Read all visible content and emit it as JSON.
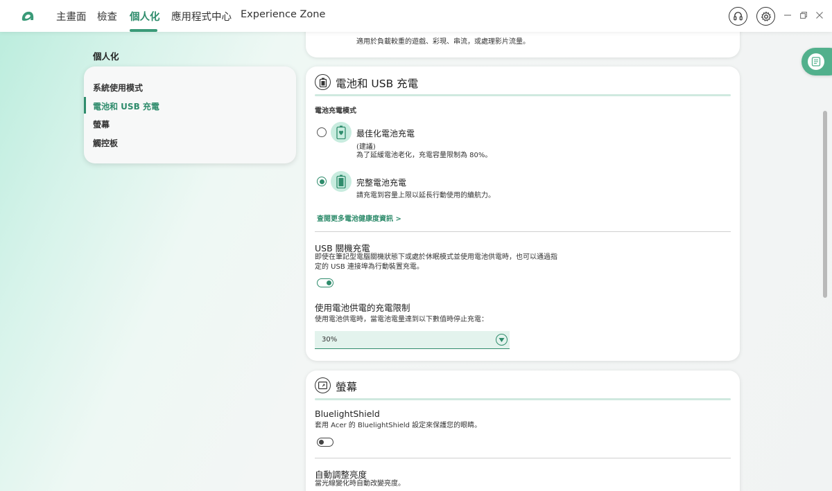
{
  "nav": {
    "tabs": [
      {
        "label": "主畫面"
      },
      {
        "label": "檢查"
      },
      {
        "label": "個人化"
      },
      {
        "label": "應用程式中心"
      },
      {
        "label": "Experience Zone"
      }
    ],
    "active_tab": "個人化"
  },
  "sidebar": {
    "section_title": "個人化",
    "items": [
      {
        "label": "系統使用模式"
      },
      {
        "label": "電池和 USB 充電"
      },
      {
        "label": "螢幕"
      },
      {
        "label": "觸控板"
      }
    ]
  },
  "top_card": {
    "description": "適用於負載較重的遊戲、彩現、串流，或處理影片流量。"
  },
  "battery_card": {
    "title": "電池和 USB 充電",
    "charge_mode_label": "電池充電模式",
    "options": [
      {
        "title": "最佳化電池充電",
        "note": "(建議)",
        "desc": "為了延緩電池老化，充電容量限制為 80%。",
        "selected": false
      },
      {
        "title": "完整電池充電",
        "desc": "請充電到容量上限以延長行動使用的續航力。",
        "selected": true
      }
    ],
    "health_link": "查閱更多電池健康度資訊 >",
    "usb_off_charge": {
      "title": "USB 關機充電",
      "desc_line1": "即使在筆記型電腦關機狀態下或處於休眠模式並使用電池供電時，也可以通過指",
      "desc_line2": "定的 USB 連接埠為行動裝置充電。",
      "enabled": true
    },
    "battery_limit": {
      "title": "使用電池供電的充電限制",
      "desc": "使用電池供電時，當電池電量達到以下數值時停止充電：",
      "selected_value": "30%"
    }
  },
  "screen_card": {
    "title": "螢幕",
    "bluelight": {
      "title": "BluelightShield",
      "desc": "套用 Acer 的 BluelightShield 設定來保護您的眼睛。",
      "enabled": false
    },
    "auto_brightness": {
      "title": "自動調整亮度",
      "desc": "當光線變化時自動改變亮度。"
    }
  },
  "colors": {
    "accent": "#2f8c6c",
    "accent_light": "#c8ecdf",
    "float_button": "#52b08c"
  },
  "icons": [
    "acer-logo-icon",
    "headset-icon",
    "gear-icon",
    "minimize-icon",
    "restore-icon",
    "close-icon",
    "battery-icon",
    "battery-heart-icon",
    "battery-full-icon",
    "monitor-icon",
    "chevron-down-icon",
    "notes-icon"
  ]
}
